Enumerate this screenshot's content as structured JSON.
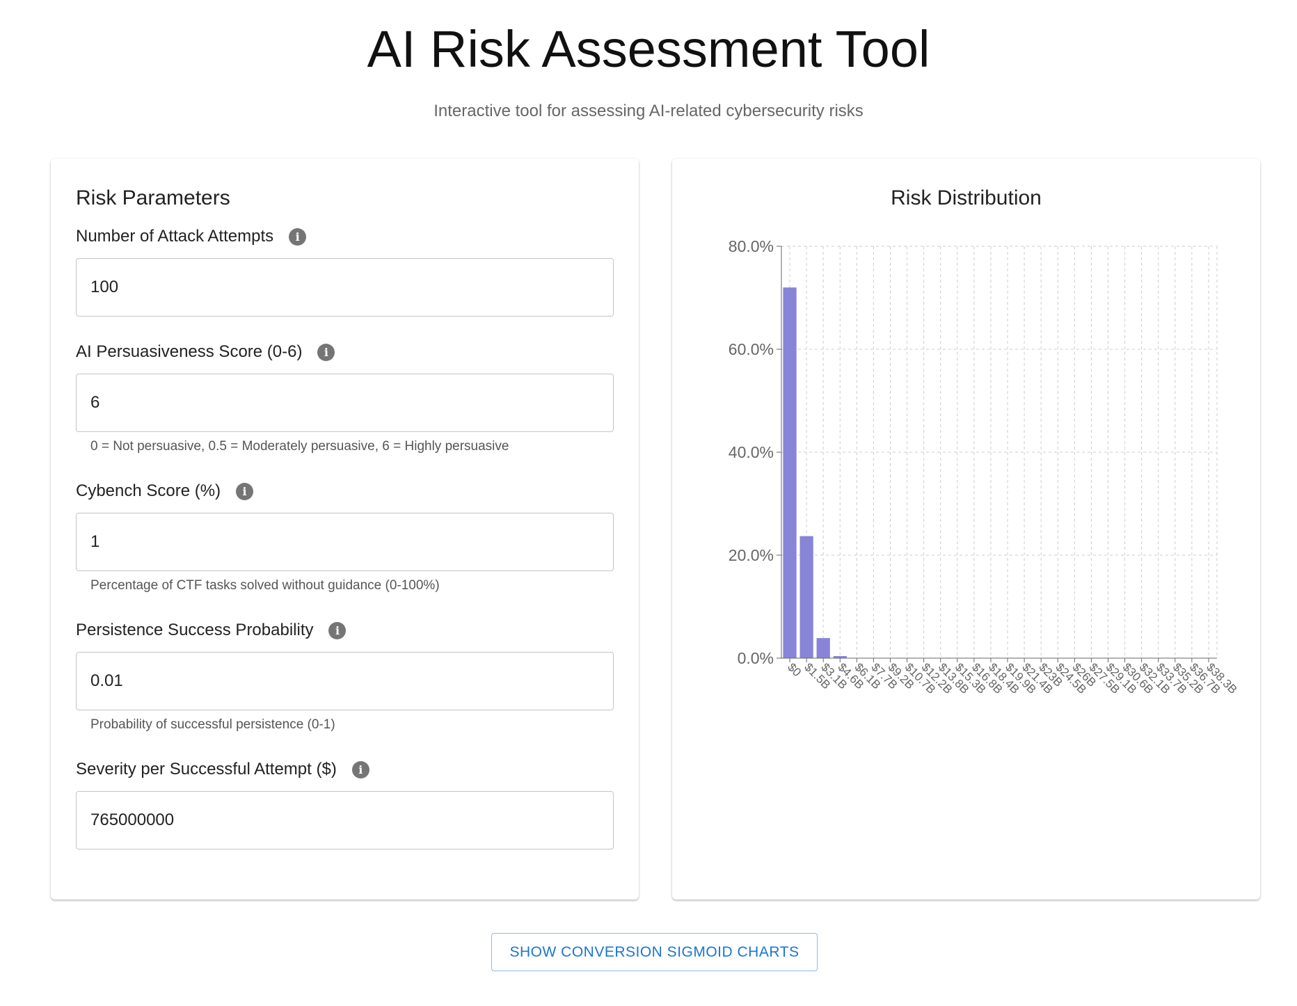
{
  "header": {
    "title": "AI Risk Assessment Tool",
    "subtitle": "Interactive tool for assessing AI-related cybersecurity risks"
  },
  "params": {
    "title": "Risk Parameters",
    "fields": [
      {
        "label": "Number of Attack Attempts",
        "value": "100",
        "helper": ""
      },
      {
        "label": "AI Persuasiveness Score (0-6)",
        "value": "6",
        "helper": "0 = Not persuasive, 0.5 = Moderately persuasive, 6 = Highly persuasive"
      },
      {
        "label": "Cybench Score (%)",
        "value": "1",
        "helper": "Percentage of CTF tasks solved without guidance (0-100%)"
      },
      {
        "label": "Persistence Success Probability",
        "value": "0.01",
        "helper": "Probability of successful persistence (0-1)"
      },
      {
        "label": "Severity per Successful Attempt ($)",
        "value": "765000000",
        "helper": ""
      }
    ]
  },
  "button": {
    "label": "SHOW CONVERSION SIGMOID CHARTS"
  },
  "chart_data": {
    "type": "bar",
    "title": "Risk Distribution",
    "xlabel": "",
    "ylabel": "",
    "ylim": [
      0,
      80
    ],
    "yticks": [
      "0.0%",
      "20.0%",
      "40.0%",
      "60.0%",
      "80.0%"
    ],
    "grid": true,
    "legend": "none",
    "color": "#8884d8",
    "categories": [
      "$0",
      "$1.5B",
      "$3.1B",
      "$4.6B",
      "$6.1B",
      "$7.7B",
      "$9.2B",
      "$10.7B",
      "$12.2B",
      "$13.8B",
      "$15.3B",
      "$16.8B",
      "$18.4B",
      "$19.9B",
      "$21.4B",
      "$23B",
      "$24.5B",
      "$26B",
      "$27.5B",
      "$29.1B",
      "$30.6B",
      "$32.1B",
      "$33.7B",
      "$35.2B",
      "$36.7B",
      "$38.3B"
    ],
    "values": [
      72.0,
      23.7,
      3.9,
      0.4,
      0.0,
      0.0,
      0.0,
      0.0,
      0.0,
      0.0,
      0.0,
      0.0,
      0.0,
      0.0,
      0.0,
      0.0,
      0.0,
      0.0,
      0.0,
      0.0,
      0.0,
      0.0,
      0.0,
      0.0,
      0.0,
      0.0
    ]
  }
}
